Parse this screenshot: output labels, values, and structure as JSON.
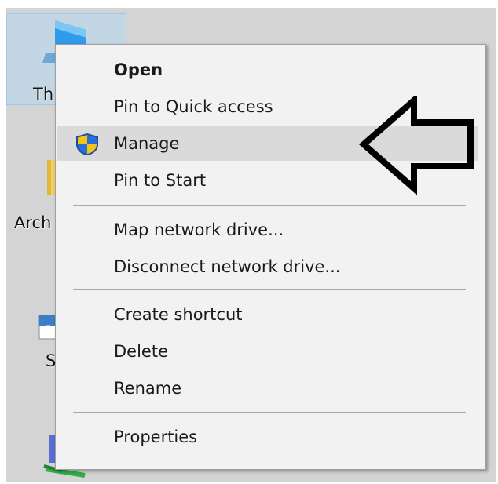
{
  "desktop": {
    "icons": [
      {
        "label": "Th"
      },
      {
        "label": "Arch"
      },
      {
        "label": "S"
      }
    ]
  },
  "context_menu": {
    "items": [
      {
        "label": "Open",
        "bold": true
      },
      {
        "label": "Pin to Quick access"
      },
      {
        "label": "Manage",
        "icon": "uac-shield-icon",
        "highlighted": true
      },
      {
        "label": "Pin to Start"
      },
      {
        "label": "Map network drive..."
      },
      {
        "label": "Disconnect network drive..."
      },
      {
        "label": "Create shortcut"
      },
      {
        "label": "Delete"
      },
      {
        "label": "Rename"
      },
      {
        "label": "Properties"
      }
    ]
  },
  "annotation": {
    "icon": "left-arrow-icon"
  },
  "colors": {
    "menu_bg": "#f2f2f2",
    "highlight": "#dadada",
    "desktop_bg": "#d4d4d4",
    "shield_blue": "#2a6fd6",
    "shield_yellow": "#f2c417"
  }
}
